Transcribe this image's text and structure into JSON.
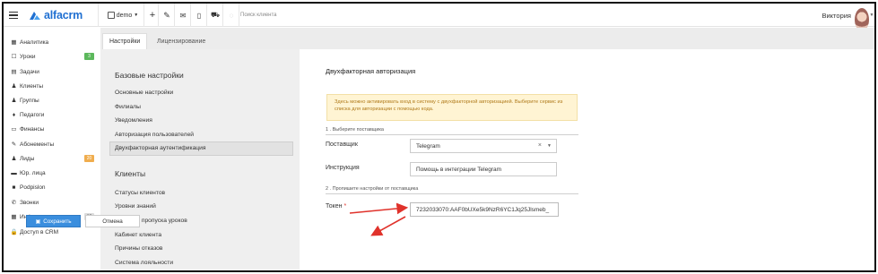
{
  "topbar": {
    "logo_text": "alfacrm",
    "branch": "demo",
    "search_placeholder": "Поиск клиента",
    "user_name": "Виктория",
    "icons": [
      "plus-icon",
      "wrench-icon",
      "mail-icon",
      "mobile-icon",
      "cart-icon",
      "clock-icon"
    ]
  },
  "sidebar": {
    "items": [
      {
        "icon": "▦",
        "label": "Аналитика"
      },
      {
        "icon": "☐",
        "label": "Уроки",
        "badge": "3",
        "badge_color": "#5cb85c"
      },
      {
        "icon": "▤",
        "label": "Задачи"
      },
      {
        "icon": "♟",
        "label": "Клиенты"
      },
      {
        "icon": "♟",
        "label": "Группы"
      },
      {
        "icon": "♦",
        "label": "Педагоги"
      },
      {
        "icon": "▭",
        "label": "Финансы"
      },
      {
        "icon": "✎",
        "label": "Абонементы"
      },
      {
        "icon": "♟",
        "label": "Лиды",
        "badge": "20",
        "badge_color": "#f0ad4e"
      },
      {
        "icon": "▬",
        "label": "Юр. лица"
      },
      {
        "icon": "■",
        "label": "Podpislon"
      },
      {
        "icon": "✆",
        "label": "Звонки"
      },
      {
        "icon": "▦",
        "label": "Информер",
        "badge": "10",
        "badge_color": "#dcdcdc"
      },
      {
        "icon": "🔒",
        "label": "Доступ в CRM"
      }
    ]
  },
  "tabs": [
    {
      "label": "Настройки",
      "active": true
    },
    {
      "label": "Лицензирование",
      "active": false
    }
  ],
  "settings_nav": {
    "base_title": "Базовые настройки",
    "base_items": [
      "Основные настройки",
      "Филиалы",
      "Уведомления",
      "Авторизация пользователей",
      "Двухфакторная аутентификация"
    ],
    "active_index": 4,
    "clients_title": "Клиенты",
    "clients_items": [
      "Статусы клиентов",
      "Уровни знаний",
      "Причины пропуска уроков",
      "Кабинет клиента",
      "Причины отказов",
      "Система лояльности"
    ]
  },
  "form": {
    "title": "Двухфакторная авторизация",
    "alert": "Здесь можно активировать вход в систему с двухфакторной авторизацией. Выберите сервис из списка для авторизации с помощью кода.",
    "section1": "1 . Выберите поставщика",
    "provider_label": "Поставщик",
    "provider_value": "Telegram",
    "instruction_label": "Инструкция",
    "instruction_value": "Помощь в интеграции Telegram",
    "section2": "2 . Пропишите настройки от поставщика",
    "token_label": "Токен",
    "token_required": "*",
    "token_value": "7232033070:AAF0bUXe5k9NzR6YC1Jq25Jlsmeb_",
    "save_label": "Сохранить",
    "cancel_label": "Отмена"
  },
  "colors": {
    "accent": "#3a8ede",
    "logo": "#1f6fd1",
    "annotation": "#e0322b",
    "alert_bg": "#fff4d3"
  }
}
